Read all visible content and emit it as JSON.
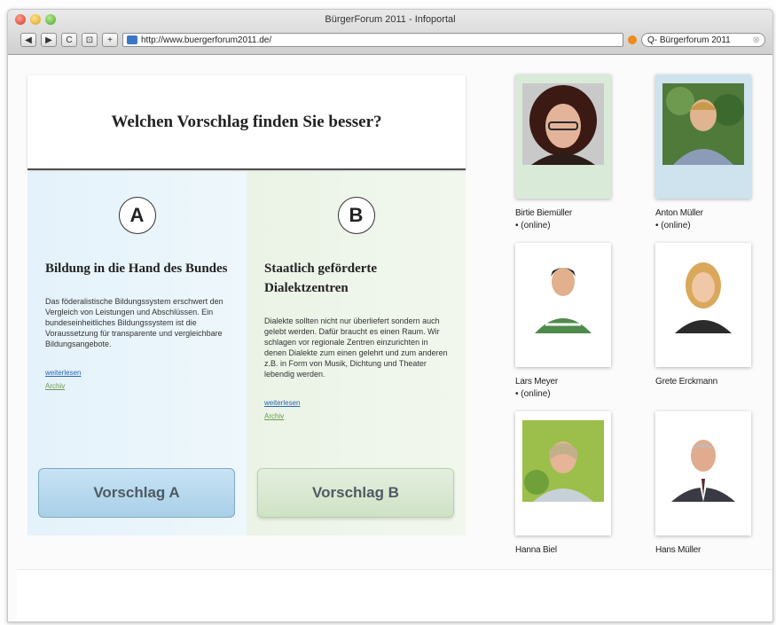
{
  "browser": {
    "title": "BürgerForum 2011 - Infoportal",
    "url": "http://www.buergerforum2011.de/",
    "search_value": "Q- Bürgerforum 2011",
    "buttons": {
      "back": "◀",
      "forward": "▶",
      "reload": "C",
      "snap": "⊡",
      "add": "+"
    }
  },
  "page": {
    "question": "Welchen Vorschlag finden Sie besser?",
    "options": [
      {
        "letter": "A",
        "title": "Bildung in die Hand des Bundes",
        "text": "Das föderalistische Bildungssystem erschwert den Vergleich von Leistungen und Abschlüssen. Ein bundeseinheitliches Bildungssystem ist die Voraussetzung für transparente und vergleichbare Bildungsangebote.",
        "more": "weiterlesen",
        "archive": "Archiv",
        "button": "Vorschlag A"
      },
      {
        "letter": "B",
        "title": "Staatlich geförderte Dialektzentren",
        "text": "Dialekte sollten nicht nur überliefert sondern auch gelebt werden. Dafür braucht es einen Raum. Wir schlagen vor regionale Zentren einzurichten in denen Dialekte zum einen gelehrt und zum anderen z.B. in Form von Musik, Dichtung und Theater lebendig werden.",
        "more": "weiterlesen",
        "archive": "Archiv",
        "button": "Vorschlag B"
      }
    ],
    "people": [
      {
        "name": "Birtie Biemüller",
        "status": "• (online)"
      },
      {
        "name": "Anton Müller",
        "status": "• (online)"
      },
      {
        "name": "Lars Meyer",
        "status": "• (online)"
      },
      {
        "name": "Grete Erckmann",
        "status": ""
      },
      {
        "name": "Hanna Biel",
        "status": ""
      },
      {
        "name": "Hans Müller",
        "status": ""
      }
    ]
  }
}
